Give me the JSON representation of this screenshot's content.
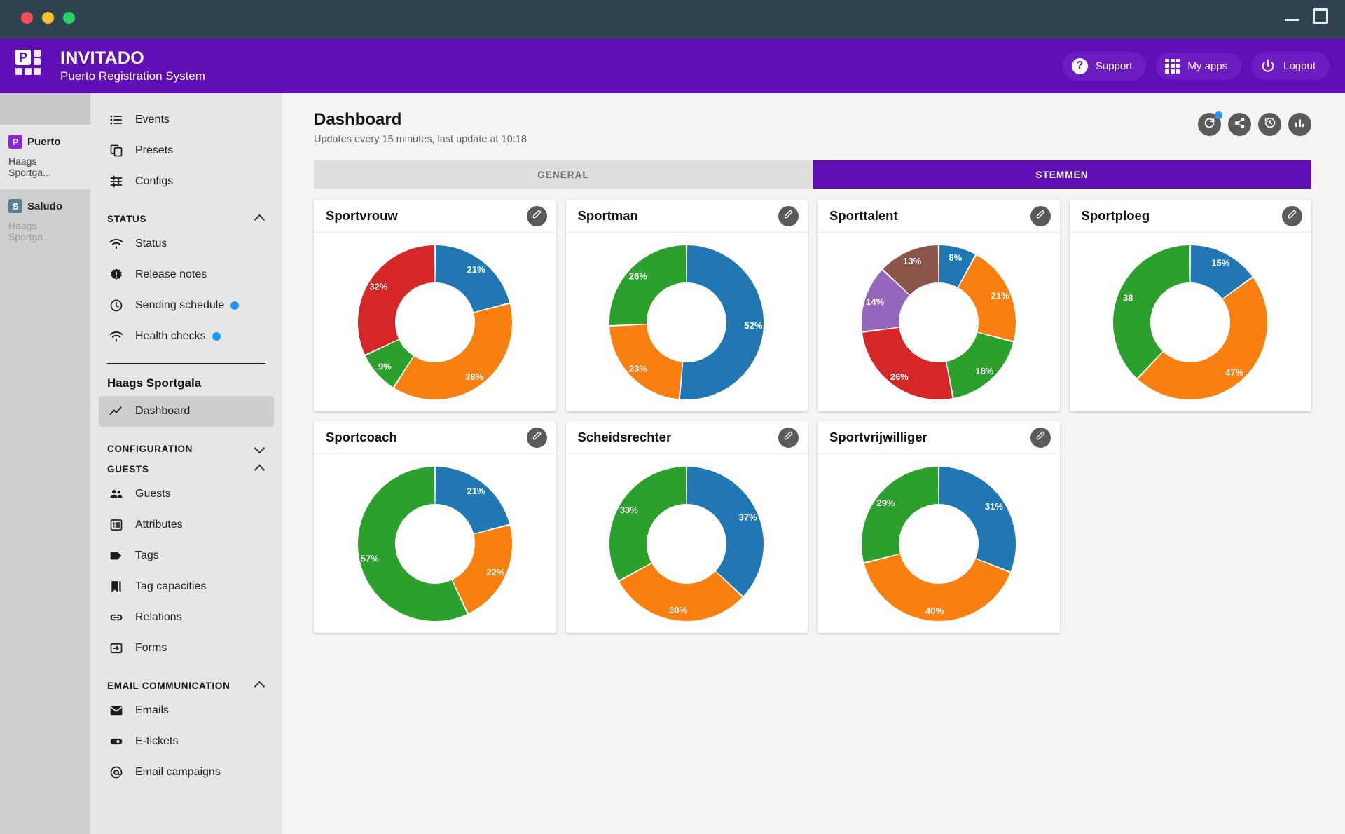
{
  "window": {
    "minimize_label": "minimize",
    "maximize_label": "maximize"
  },
  "header": {
    "brand_title": "INVITADO",
    "brand_subtitle": "Puerto Registration System",
    "brand_color": "#5f0fb3",
    "actions": [
      {
        "label": "Support",
        "icon": "question-circle-icon"
      },
      {
        "label": "My apps",
        "icon": "grid-apps-icon"
      },
      {
        "label": "Logout",
        "icon": "power-icon"
      }
    ]
  },
  "app_rail": [
    {
      "badge": "P",
      "name": "Puerto",
      "sub": "Haags Sportga...",
      "active": true
    },
    {
      "badge": "S",
      "name": "Saludo",
      "sub": "Haags Sportga...",
      "active": false
    }
  ],
  "sidebar": {
    "top_items": [
      {
        "label": "Events",
        "icon": "list-icon"
      },
      {
        "label": "Presets",
        "icon": "copy-icon"
      },
      {
        "label": "Configs",
        "icon": "sliders-icon"
      }
    ],
    "status_section": {
      "label": "STATUS",
      "expanded": true
    },
    "status_items": [
      {
        "label": "Status",
        "icon": "wifi-icon",
        "badge": false
      },
      {
        "label": "Release notes",
        "icon": "badge-alert-icon",
        "badge": false
      },
      {
        "label": "Sending schedule",
        "icon": "clock-icon",
        "badge": true
      },
      {
        "label": "Health checks",
        "icon": "wifi-icon",
        "badge": true
      }
    ],
    "event_title": "Haags Sportgala",
    "dashboard_item": {
      "label": "Dashboard",
      "icon": "trend-line-icon",
      "active": true
    },
    "configuration_section": {
      "label": "CONFIGURATION",
      "expanded": false
    },
    "guests_section": {
      "label": "GUESTS",
      "expanded": true
    },
    "guests_items": [
      {
        "label": "Guests",
        "icon": "people-icon"
      },
      {
        "label": "Attributes",
        "icon": "attributes-icon"
      },
      {
        "label": "Tags",
        "icon": "tag-icon"
      },
      {
        "label": "Tag capacities",
        "icon": "bookmark-icon"
      },
      {
        "label": "Relations",
        "icon": "link-icon"
      },
      {
        "label": "Forms",
        "icon": "form-arrow-icon"
      }
    ],
    "email_section": {
      "label": "EMAIL COMMUNICATION",
      "expanded": true
    },
    "email_items": [
      {
        "label": "Emails",
        "icon": "envelope-icon"
      },
      {
        "label": "E-tickets",
        "icon": "ticket-icon"
      },
      {
        "label": "Email campaigns",
        "icon": "at-sign-icon"
      }
    ]
  },
  "main": {
    "page_title": "Dashboard",
    "page_subtitle": "Updates every 15 minutes, last update at 10:18",
    "head_actions": [
      {
        "icon": "refresh-icon",
        "notify": true
      },
      {
        "icon": "share-icon",
        "notify": false
      },
      {
        "icon": "history-icon",
        "notify": false
      },
      {
        "icon": "bar-chart-icon",
        "notify": false
      }
    ],
    "tabs": [
      {
        "label": "GENERAL",
        "active": false
      },
      {
        "label": "STEMMEN",
        "active": true
      }
    ]
  },
  "palette": {
    "blue": "#2077b4",
    "orange": "#f98010",
    "green": "#2ca02c",
    "red": "#d62728",
    "purple": "#9467bd",
    "brown": "#8c564b"
  },
  "chart_data": [
    {
      "type": "pie",
      "title": "Sportvrouw",
      "labels": [
        "21%",
        "38%",
        "9%",
        "32%"
      ],
      "values": [
        21,
        38,
        9,
        32
      ],
      "colors": [
        "#2077b4",
        "#f98010",
        "#2ca02c",
        "#d62728"
      ],
      "donut": true,
      "legend": "none"
    },
    {
      "type": "pie",
      "title": "Sportman",
      "labels": [
        "52%",
        "23%",
        "26%"
      ],
      "values": [
        52,
        23,
        26
      ],
      "colors": [
        "#2077b4",
        "#f98010",
        "#2ca02c"
      ],
      "donut": true,
      "legend": "none"
    },
    {
      "type": "pie",
      "title": "Sporttalent",
      "labels": [
        "8%",
        "21%",
        "18%",
        "26%",
        "14%",
        "13%"
      ],
      "values": [
        8,
        21,
        18,
        26,
        14,
        13
      ],
      "colors": [
        "#2077b4",
        "#f98010",
        "#2ca02c",
        "#d62728",
        "#9467bd",
        "#8c564b"
      ],
      "donut": true,
      "legend": "none"
    },
    {
      "type": "pie",
      "title": "Sportploeg",
      "labels": [
        "15%",
        "47%",
        "38"
      ],
      "values": [
        15,
        47,
        38
      ],
      "colors": [
        "#2077b4",
        "#f98010",
        "#2ca02c"
      ],
      "donut": true,
      "legend": "none"
    },
    {
      "type": "pie",
      "title": "Sportcoach",
      "labels": [
        "21%",
        "22%",
        "57%"
      ],
      "values": [
        21,
        22,
        57
      ],
      "colors": [
        "#2077b4",
        "#f98010",
        "#2ca02c"
      ],
      "donut": true,
      "legend": "none"
    },
    {
      "type": "pie",
      "title": "Scheidsrechter",
      "labels": [
        "37%",
        "30%",
        "33%"
      ],
      "values": [
        37,
        30,
        33
      ],
      "colors": [
        "#2077b4",
        "#f98010",
        "#2ca02c"
      ],
      "donut": true,
      "legend": "none"
    },
    {
      "type": "pie",
      "title": "Sportvrijwilliger",
      "labels": [
        "31%",
        "40%",
        "29%"
      ],
      "values": [
        31,
        40,
        29
      ],
      "colors": [
        "#2077b4",
        "#f98010",
        "#2ca02c"
      ],
      "donut": true,
      "legend": "none"
    }
  ]
}
